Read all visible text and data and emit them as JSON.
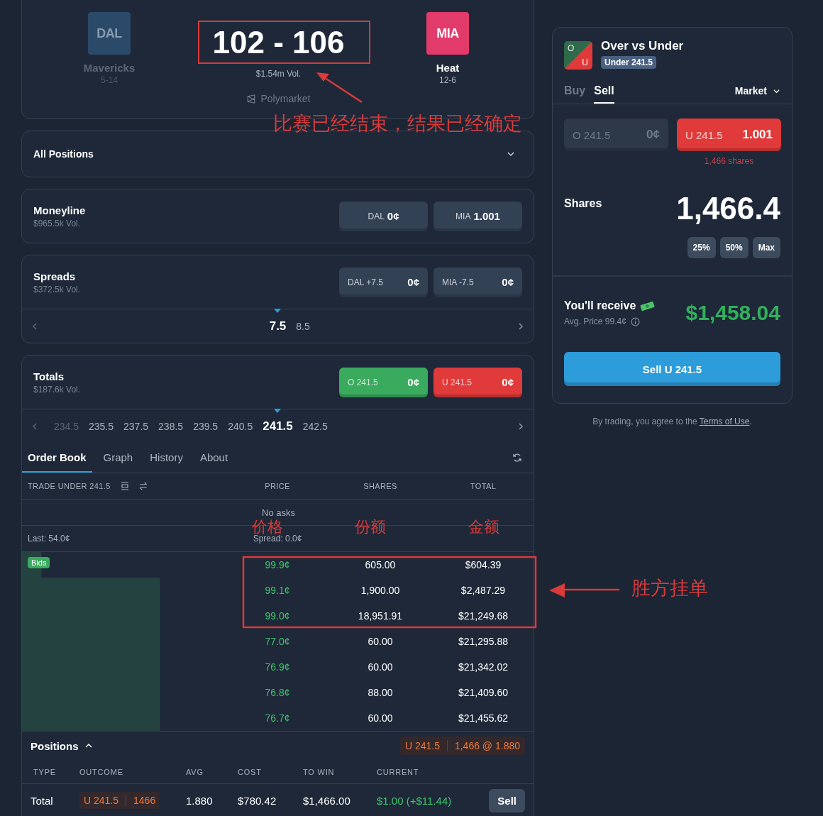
{
  "game": {
    "teams": [
      {
        "abbr": "DAL",
        "name": "Mavericks",
        "record": "5-14",
        "dimmed": true,
        "color": "#2b4a6a"
      },
      {
        "abbr": "MIA",
        "name": "Heat",
        "record": "12-6",
        "dimmed": false,
        "color": "#e23a6b"
      }
    ],
    "score": "102 - 106",
    "volume": "$1.54m Vol.",
    "source": "Polymarket"
  },
  "all_positions": {
    "label": "All Positions",
    "expanded": false
  },
  "markets": [
    {
      "title": "Moneyline",
      "volume": "$965.5k Vol.",
      "kind": "center",
      "buttons": [
        {
          "label": "DAL",
          "price": "0¢",
          "color": "#334155"
        },
        {
          "label": "MIA",
          "price": "1.001",
          "color": "#334155"
        }
      ]
    },
    {
      "title": "Spreads",
      "volume": "$372.5k Vol.",
      "kind": "spread",
      "buttons": [
        {
          "label": "DAL +7.5",
          "price": "0¢",
          "color": "#334155"
        },
        {
          "label": "MIA -7.5",
          "price": "0¢",
          "color": "#334155"
        }
      ],
      "lines": [
        {
          "value": "7.5",
          "selected": true
        },
        {
          "value": "8.5",
          "selected": false
        }
      ]
    }
  ],
  "totals": {
    "title": "Totals",
    "volume": "$187.6k Vol.",
    "buttons": [
      {
        "label": "O 241.5",
        "price": "0¢",
        "color": "#3aaa5e"
      },
      {
        "label": "U 241.5",
        "price": "0¢",
        "color": "#e03a3a"
      }
    ],
    "lines": [
      {
        "value": "234.5",
        "selected": false
      },
      {
        "value": "235.5",
        "selected": false
      },
      {
        "value": "237.5",
        "selected": false
      },
      {
        "value": "238.5",
        "selected": false
      },
      {
        "value": "239.5",
        "selected": false
      },
      {
        "value": "240.5",
        "selected": false
      },
      {
        "value": "241.5",
        "selected": true
      },
      {
        "value": "242.5",
        "selected": false
      }
    ],
    "tabs": [
      {
        "label": "Order Book",
        "selected": true
      },
      {
        "label": "Graph",
        "selected": false
      },
      {
        "label": "History",
        "selected": false
      },
      {
        "label": "About",
        "selected": false
      }
    ],
    "book": {
      "trade_label": "TRADE UNDER 241.5",
      "columns": [
        "PRICE",
        "SHARES",
        "TOTAL"
      ],
      "asks_note": "No asks",
      "last": "Last: 54.0¢",
      "spread": "Spread: 0.0¢",
      "bids_label": "Bids",
      "bids": [
        {
          "price": "99.9¢",
          "shares": "605.00",
          "total": "$604.39"
        },
        {
          "price": "99.1¢",
          "shares": "1,900.00",
          "total": "$2,487.29"
        },
        {
          "price": "99.0¢",
          "shares": "18,951.91",
          "total": "$21,249.68"
        },
        {
          "price": "77.0¢",
          "shares": "60.00",
          "total": "$21,295.88"
        },
        {
          "price": "76.9¢",
          "shares": "60.00",
          "total": "$21,342.02"
        },
        {
          "price": "76.8¢",
          "shares": "88.00",
          "total": "$21,409.60"
        },
        {
          "price": "76.7¢",
          "shares": "60.00",
          "total": "$21,455.62"
        }
      ]
    },
    "positions": {
      "title": "Positions",
      "expanded": true,
      "summary": {
        "outcome": "U 241.5",
        "detail": "1,466 @ 1.880"
      },
      "columns": [
        "TYPE",
        "OUTCOME",
        "AVG",
        "COST",
        "TO WIN",
        "CURRENT"
      ],
      "rows": [
        {
          "type": "Total",
          "outcome": "U 241.5",
          "shares": "1466",
          "avg": "1.880",
          "cost": "$780.42",
          "to_win": "$1,466.00",
          "current": "$1.00",
          "change": "(+$11.44)",
          "action": "Sell"
        }
      ]
    }
  },
  "trade": {
    "icon_top": "O",
    "icon_bottom": "U",
    "title": "Over vs Under",
    "badge": "Under 241.5",
    "sides": [
      {
        "label": "Buy",
        "selected": false
      },
      {
        "label": "Sell",
        "selected": true
      }
    ],
    "order_type": "Market",
    "outcomes": [
      {
        "label": "O 241.5",
        "price": "0¢",
        "selected": false,
        "color": "#2d3848"
      },
      {
        "label": "U 241.5",
        "price": "1.001",
        "selected": true,
        "color": "#e03a3a"
      }
    ],
    "held": "1,466 shares",
    "shares_label": "Shares",
    "shares_value": "1,466.4",
    "quick": [
      "25%",
      "50%",
      "Max"
    ],
    "receive_label": "You'll receive",
    "avg_price": "Avg. Price 99.4¢",
    "receive_value": "$1,458.04",
    "submit": "Sell U 241.5",
    "terms": {
      "before": "By trading, you agree to the ",
      "link": "Terms of Use",
      "after": "."
    }
  },
  "annotations": {
    "score_note": "比赛已经结束，结果已经确定",
    "column_labels": [
      "价格",
      "份额",
      "金额"
    ],
    "bids_note": "胜方挂单"
  }
}
